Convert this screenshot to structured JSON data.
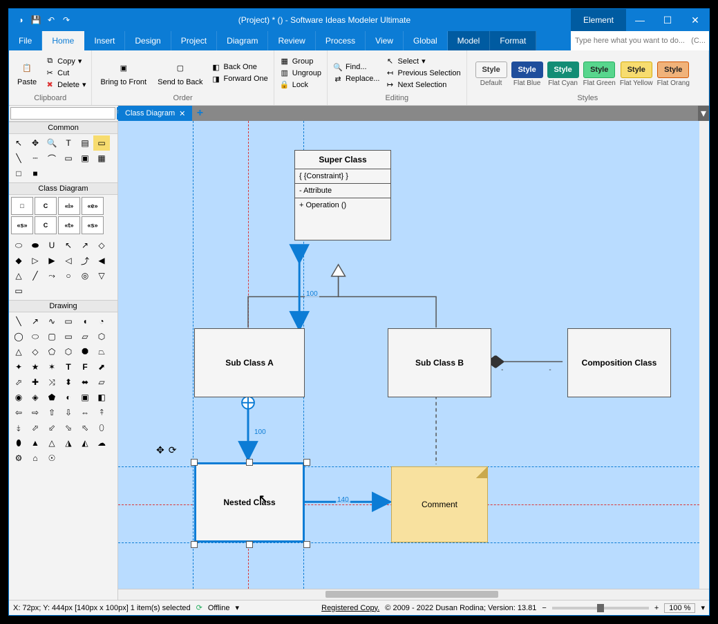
{
  "titlebar": {
    "title": "(Project) *  ()  - Software Ideas Modeler Ultimate",
    "element_tab": "Element"
  },
  "menu": {
    "items": [
      "File",
      "Home",
      "Insert",
      "Design",
      "Project",
      "Diagram",
      "Review",
      "Process",
      "View",
      "Global",
      "Model",
      "Format"
    ],
    "active_index": 1,
    "search_placeholder": "Type here what you want to do...   (C..."
  },
  "ribbon": {
    "clipboard": {
      "paste": "Paste",
      "copy": "Copy",
      "cut": "Cut",
      "delete": "Delete",
      "label": "Clipboard"
    },
    "order": {
      "bring_front": "Bring to Front",
      "send_back": "Send to Back",
      "back_one": "Back One",
      "forward_one": "Forward One",
      "label": "Order"
    },
    "groups": {
      "group": "Group",
      "ungroup": "Ungroup",
      "lock": "Lock"
    },
    "editing": {
      "find": "Find...",
      "replace": "Replace...",
      "select": "Select",
      "prev_sel": "Previous Selection",
      "next_sel": "Next Selection",
      "label": "Editing"
    },
    "styles": {
      "label": "Styles",
      "items": [
        {
          "bg": "#f5f5f5",
          "fg": "#333",
          "border": "#aaa",
          "text": "Style",
          "name": "Default"
        },
        {
          "bg": "#1f4e9c",
          "fg": "#fff",
          "border": "#1f4e9c",
          "text": "Style",
          "name": "Flat Blue"
        },
        {
          "bg": "#138d75",
          "fg": "#fff",
          "border": "#138d75",
          "text": "Style",
          "name": "Flat Cyan"
        },
        {
          "bg": "#58d68d",
          "fg": "#222",
          "border": "#27ae60",
          "text": "Style",
          "name": "Flat Green"
        },
        {
          "bg": "#f7dc6f",
          "fg": "#222",
          "border": "#d4ac0d",
          "text": "Style",
          "name": "Flat Yellow"
        },
        {
          "bg": "#f0b27a",
          "fg": "#222",
          "border": "#d35400",
          "text": "Style",
          "name": "Flat Orang"
        }
      ]
    }
  },
  "toolpanels": {
    "common": "Common",
    "class_diagram": "Class Diagram",
    "drawing": "Drawing",
    "cd_tools": [
      "□",
      "C",
      "«i»",
      "«e»",
      "«s»",
      "C",
      "«t»",
      "«s»"
    ]
  },
  "tabs": {
    "active": "Class Diagram"
  },
  "diagram": {
    "super_class": {
      "title": "Super Class",
      "constraint": "{ {Constraint}  }",
      "attribute": "- Attribute",
      "operation": "+ Operation ()"
    },
    "sub_a": "Sub Class A",
    "sub_b": "Sub Class B",
    "composition": "Composition Class",
    "nested": "Nested Class",
    "comment": "Comment",
    "dim_140": "140",
    "dim_100_top": "100",
    "dim_100_mid": "100"
  },
  "statusbar": {
    "coords": "X: 72px; Y: 444px  [140px x 100px] 1 item(s) selected",
    "offline": "Offline",
    "registered": "Registered Copy.",
    "copyright": "© 2009 - 2022 Dusan Rodina; Version: 13.81",
    "zoom": "100 %"
  }
}
